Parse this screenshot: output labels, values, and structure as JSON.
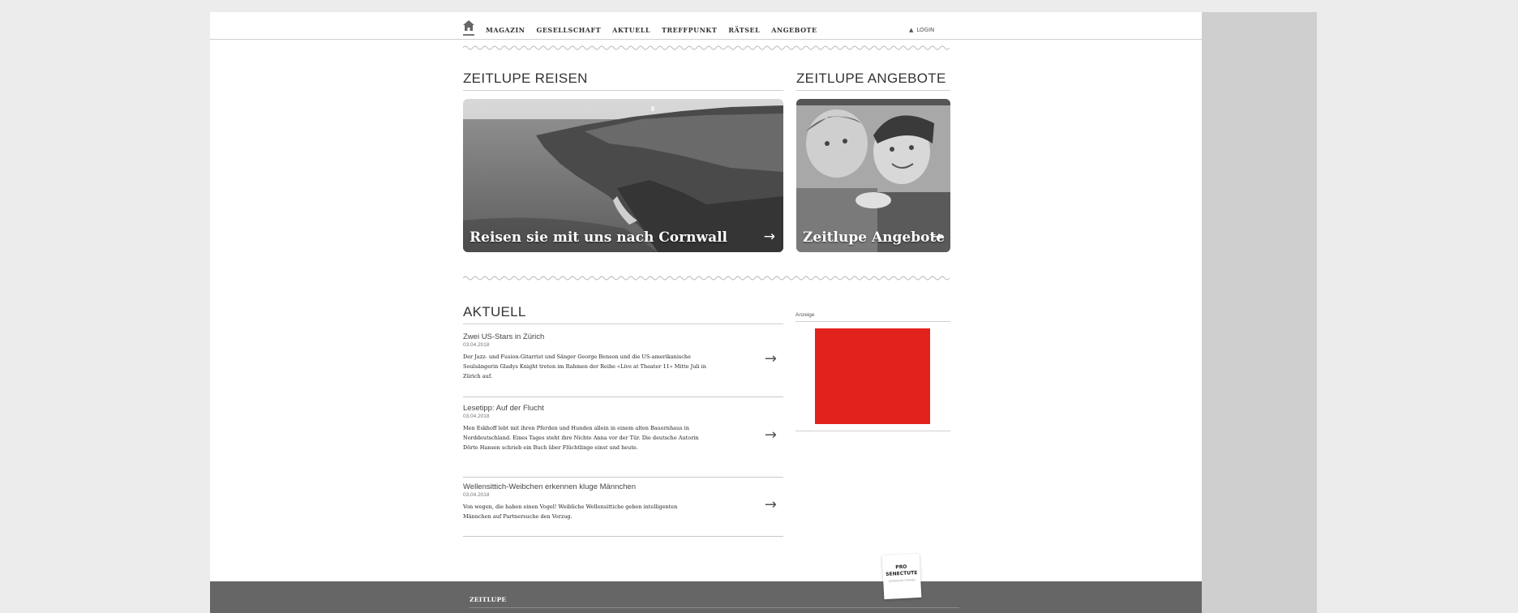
{
  "nav": {
    "items": [
      "MAGAZIN",
      "GESELLSCHAFT",
      "AKTUELL",
      "TREFFPUNKT",
      "RÄTSEL",
      "ANGEBOTE"
    ],
    "login": "LOGIN"
  },
  "reisen": {
    "title": "ZEITLUPE REISEN",
    "caption": "Reisen sie mit uns nach Cornwall"
  },
  "angebote": {
    "title": "ZEITLUPE ANGEBOTE",
    "caption": "Zeitlupe Angebote"
  },
  "aktuell": {
    "title": "AKTUELL",
    "items": [
      {
        "title": "Zwei US-Stars in Zürich",
        "date": "03.04.2018",
        "text": "Der Jazz- und Fusion-Gitarrist und Sänger George Benson und die US-amerikanische Soulsängerin Gladys Knight treten im Rahmen der Reihe «Live at Theater 11» Mitte Juli in Zürich auf."
      },
      {
        "title": "Lesetipp: Auf der Flucht",
        "date": "03.04.2018",
        "text": "Men Eskhoff lebt mit ihren Pferden und Hunden allein in einem alten Bauernhaus in Norddeutschland. Eines Tages steht ihre Nichte Anna vor der Tür. Die deutsche Autorin Dörte Hansen schrieb ein Buch über Flüchtlinge einst und heute."
      },
      {
        "title": "Wellensittich-Weibchen erkennen kluge Männchen",
        "date": "03.04.2018",
        "text": "Von wegen, die haben einen Vogel! Weibliche Wellensittiche geben intelligenten Männchen auf Partnersuche den Vorzug."
      }
    ]
  },
  "ad": {
    "label": "Anzeige",
    "color": "#e2221d"
  },
  "footer": {
    "brand": "ZEITLUPE",
    "logo_line1": "PRO",
    "logo_line2": "SENECTUTE",
    "logo_sub": "GEMEINSAM STÄRKER"
  }
}
